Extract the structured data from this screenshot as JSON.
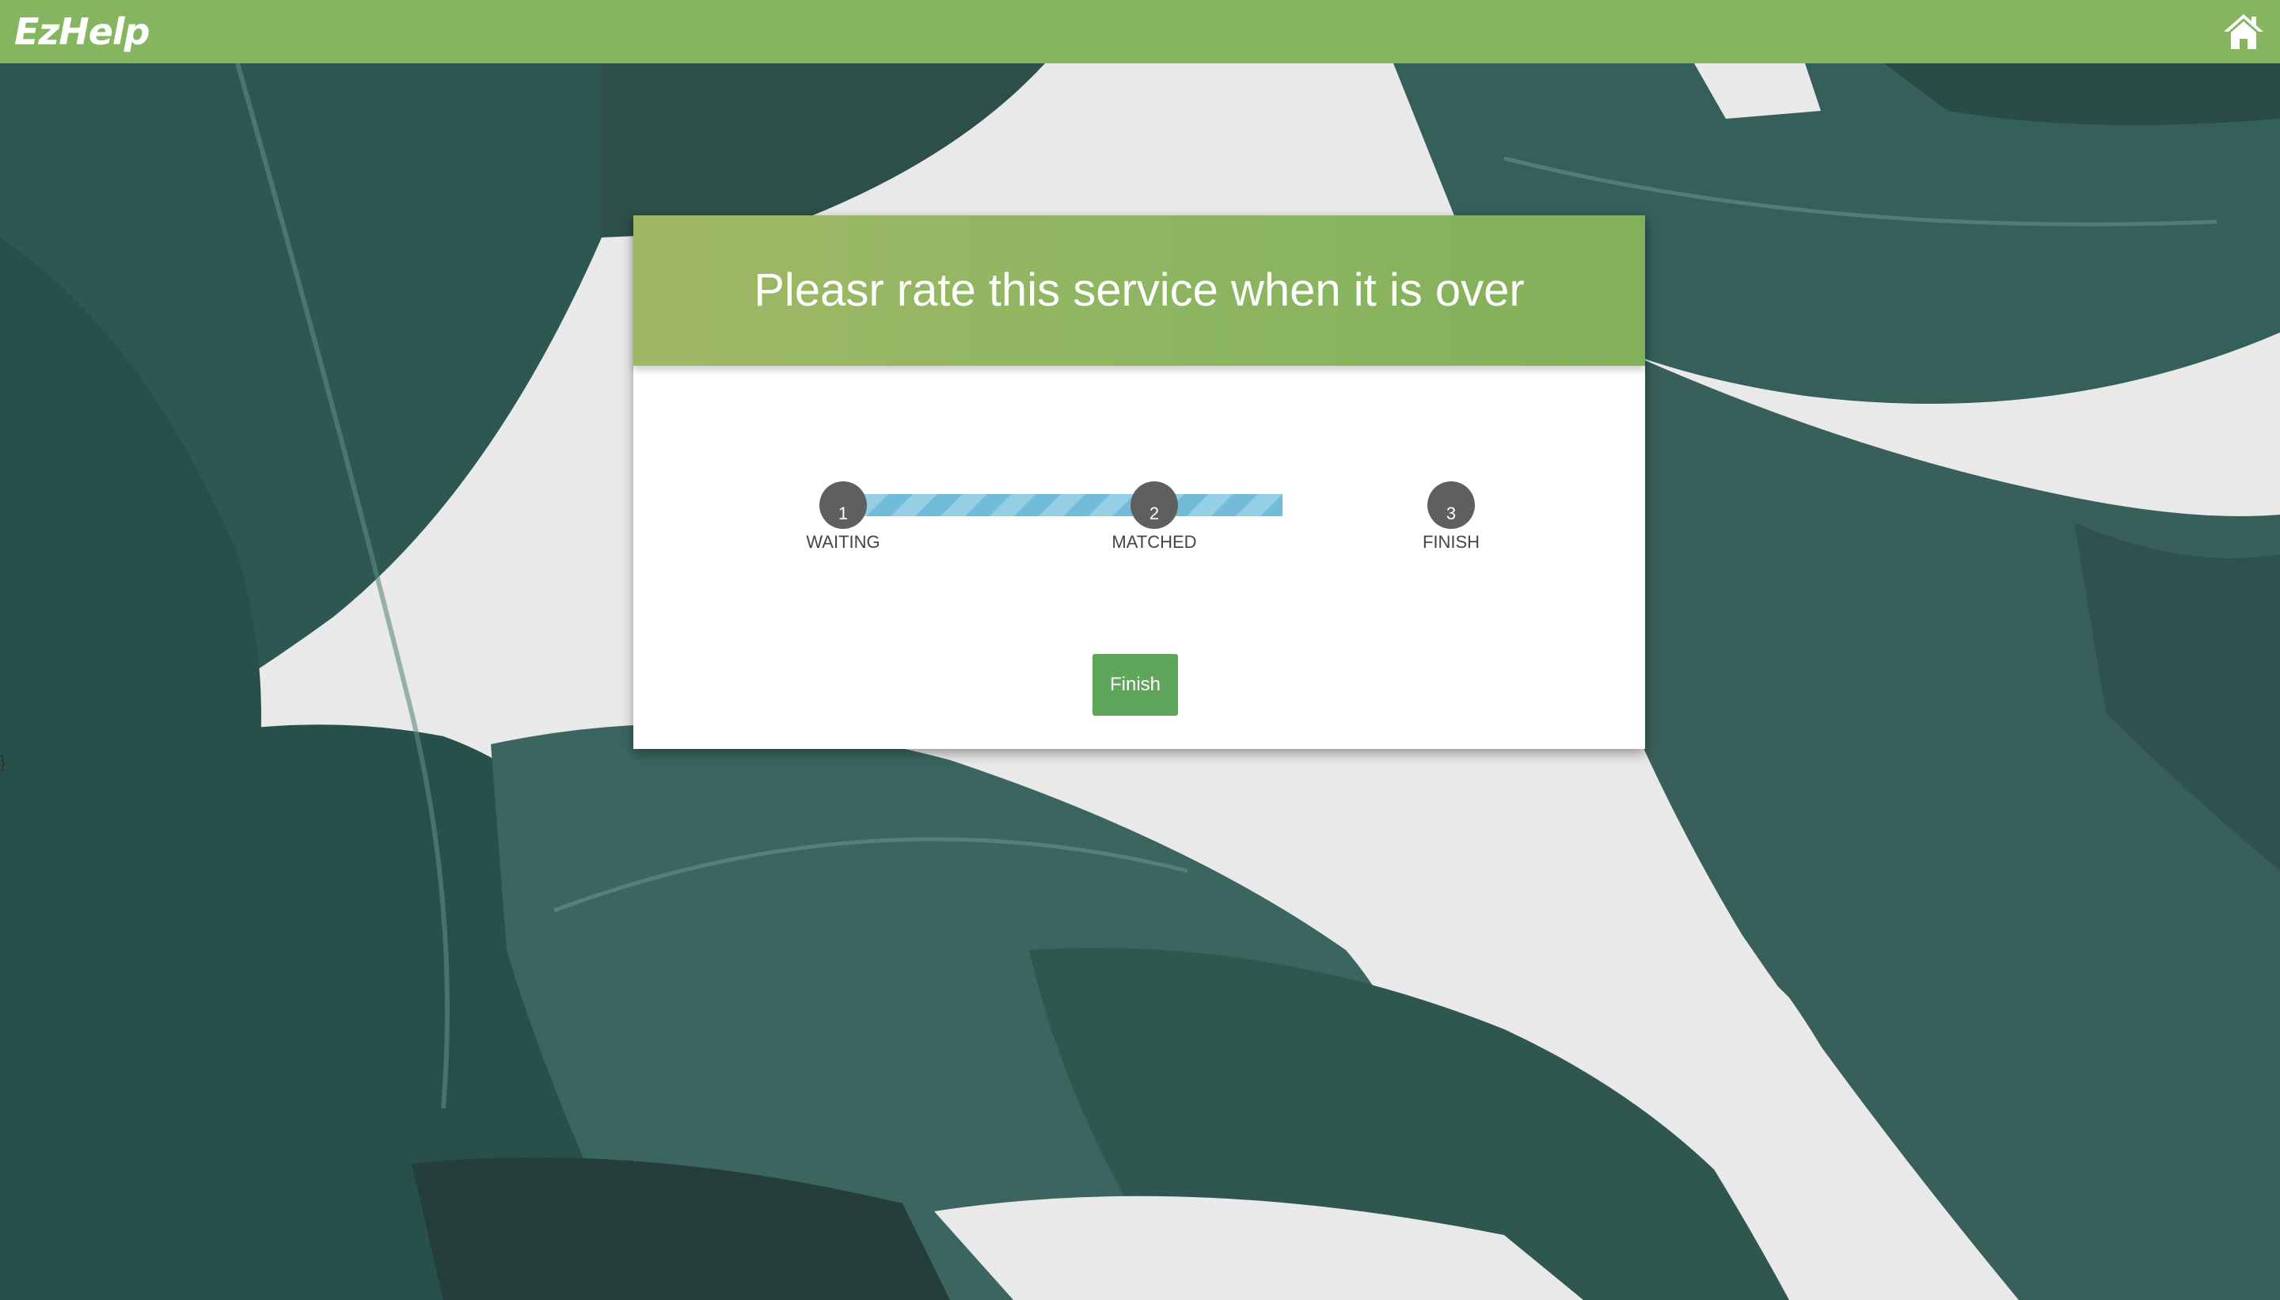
{
  "app": {
    "brand": "EzHelp",
    "home_icon": "home-icon"
  },
  "dialog": {
    "title": "Pleasr rate this service when it is over",
    "steps": [
      {
        "number": "1",
        "label": "WAITING"
      },
      {
        "number": "2",
        "label": "MATCHED"
      },
      {
        "number": "3",
        "label": "FINISH"
      }
    ],
    "finish_label": "Finish"
  },
  "stray_text": "}",
  "colors": {
    "topbar": "#85b55f",
    "header_start": "#a0b865",
    "header_end": "#83b05a",
    "progress_track": "#72bcd9",
    "step_dot": "#5f5f5f",
    "button": "#5fa65a"
  }
}
